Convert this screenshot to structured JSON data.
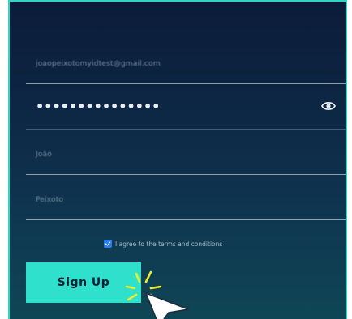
{
  "form": {
    "email_value": "joaopeixotomyidtest@gmail.com",
    "password_value": "•••••••••••••••",
    "first_name_value": "João",
    "last_name_value": "Peixoto"
  },
  "terms": {
    "checked": true,
    "label": "I agree to the terms and conditions"
  },
  "signup_button": {
    "label": "Sign Up"
  },
  "icons": {
    "password_toggle": "eye-icon",
    "checkbox": "checkmark-icon",
    "pointer": "cursor-arrow-icon",
    "click_highlight": "click-burst-icon"
  },
  "colors": {
    "accent": "#2fe0cc",
    "background_top": "#0b1c3a",
    "background_bottom": "#0f4655",
    "checkbox": "#2a7cf0",
    "click_highlight": "#e9f02b"
  }
}
